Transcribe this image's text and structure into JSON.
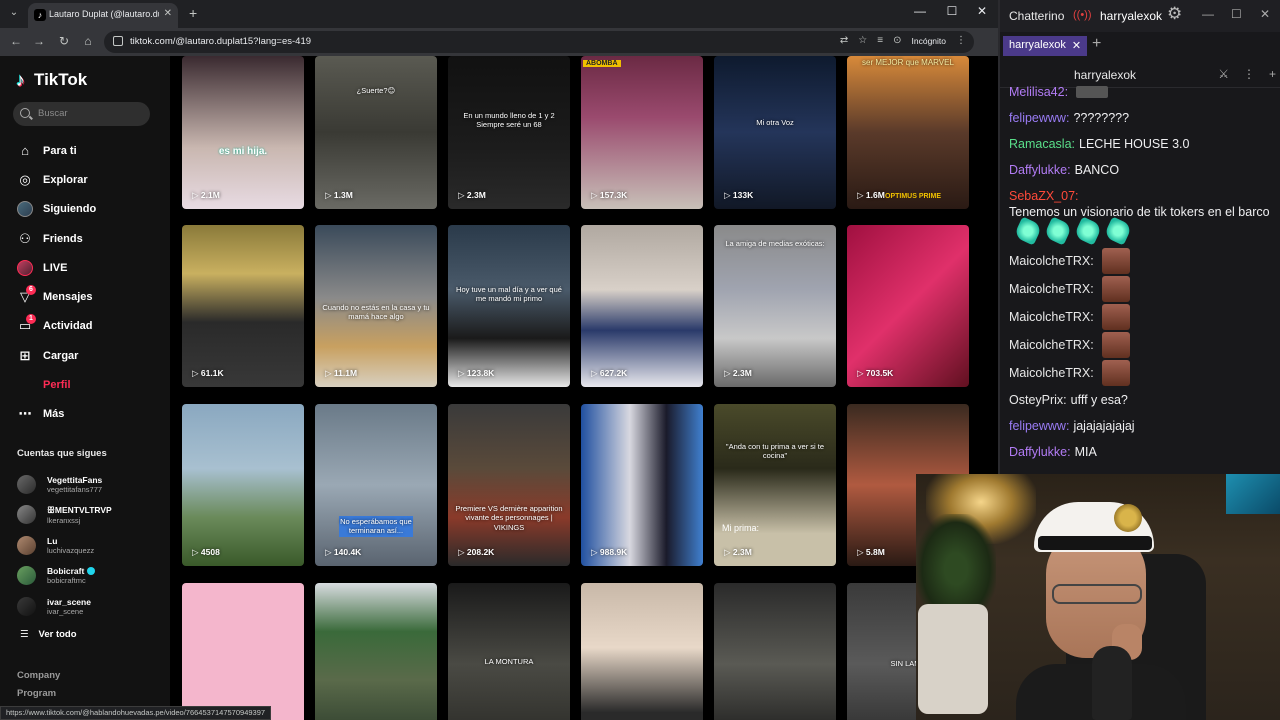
{
  "browser": {
    "tab_title": "Lautaro Duplat (@lautaro.duplat",
    "url": "tiktok.com/@lautaro.duplat15?lang=es-419",
    "incognito_label": "Incógnito",
    "status_url": "https://www.tiktok.com/@hablandohuevadas.pe/video/7664537147570949397"
  },
  "tiktok": {
    "logo": "TikTok",
    "search_placeholder": "Buscar",
    "nav": [
      {
        "label": "Para ti",
        "icon": "home-icon"
      },
      {
        "label": "Explorar",
        "icon": "compass-icon"
      },
      {
        "label": "Siguiendo",
        "icon": "following-avatar-icon"
      },
      {
        "label": "Friends",
        "icon": "friends-icon"
      },
      {
        "label": "LIVE",
        "icon": "live-icon"
      },
      {
        "label": "Mensajes",
        "icon": "messages-icon",
        "badge": "6"
      },
      {
        "label": "Actividad",
        "icon": "activity-icon",
        "badge": "1"
      },
      {
        "label": "Cargar",
        "icon": "upload-icon"
      },
      {
        "label": "Perfil",
        "icon": "profile-icon"
      },
      {
        "label": "Más",
        "icon": "more-icon"
      }
    ],
    "following_title": "Cuentas que sigues",
    "following": [
      {
        "name": "VegettitaFans",
        "handle": "vegettitafans777"
      },
      {
        "name": "ꕥMENTVLTRVP",
        "handle": "lkeranxssj"
      },
      {
        "name": "Lu",
        "handle": "luchivazquezz"
      },
      {
        "name": "Bobicraft",
        "handle": "bobicraftmc",
        "verified": true
      },
      {
        "name": "ivar_scene",
        "handle": "ivar_scene"
      }
    ],
    "see_all": "Ver todo",
    "footer": [
      "Company",
      "Program"
    ]
  },
  "videos": [
    {
      "views": "2.1M",
      "caption": "es mi hija.",
      "bg": "linear-gradient(180deg,#3a2a30,#c9b7b0 60%,#e8dbe3)"
    },
    {
      "views": "1.3M",
      "caption": "¿Suerte?😊",
      "bg": "linear-gradient(180deg,#5a5a52,#3a3a34 50%,#6a6a64)"
    },
    {
      "views": "2.3M",
      "caption": "En un mundo lleno de 1 y 2 Siempre seré un 68",
      "bg": "linear-gradient(180deg,#111,#1c1c1c 60%,#2a2a2a)"
    },
    {
      "views": "157.3K",
      "caption": "",
      "bg": "linear-gradient(180deg,#6b2a44,#9a4a6e 40%,#c8c0b8)"
    },
    {
      "views": "133K",
      "caption": "Mi otra Voz",
      "bg": "linear-gradient(180deg,#0e1a2e,#24355a 50%,#111826)"
    },
    {
      "views": "1.6M",
      "caption": "ser MEJOR que MARVEL",
      "bg": "linear-gradient(180deg,#d88a3a,#5a3a2a 50%,#2a1a14)"
    },
    {
      "views": "61.1K",
      "caption": "",
      "bg": "linear-gradient(180deg,#8a7a3a,#c9b060 30%,#2a2a2a 60%,#383838)"
    },
    {
      "views": "11.1M",
      "caption": "Cuando no estás en la casa y tu mamá hace algo",
      "bg": "linear-gradient(180deg,#3a4a5a,#8a8a8a 45%,#c8a060 75%,#d8d0c0)"
    },
    {
      "views": "123.8K",
      "caption": "Hoy tuve un mal día y a ver qué me mandó mi primo",
      "bg": "linear-gradient(180deg,#2a3a4a,#4a5a6a 40%,#1a1a1a 70%,#e8e8e8)"
    },
    {
      "views": "627.2K",
      "caption": "",
      "bg": "linear-gradient(180deg,#b0a8a0,#d8d0c8 40%,#2a3a6a 65%,#e8e8ee)"
    },
    {
      "views": "2.3M",
      "caption": "La amiga de medias exóticas:",
      "bg": "linear-gradient(180deg,#8a8a8a,#a0a4b0 40%,#c8c8c8 70%,#6a6a6a)"
    },
    {
      "views": "703.5K",
      "caption": "",
      "bg": "linear-gradient(135deg,#a01040,#e0306a 50%,#601020)"
    },
    {
      "views": "4508",
      "caption": "",
      "bg": "linear-gradient(180deg,#8aa8c0,#a8c0d0 40%,#6a8a5a 70%,#3a5a2a)"
    },
    {
      "views": "140.4K",
      "caption": "No esperábamos que terminaran así...",
      "bg": "linear-gradient(180deg,#6a7a88,#9aa8b4 50%,#5a6470)"
    },
    {
      "views": "208.2K",
      "caption": "Premiere VS dernière apparition vivante des personnages | VIKINGS",
      "bg": "linear-gradient(180deg,#3a3a3a,#5a4a3a 40%,#8a3a2a 70%,#2a2a2a)"
    },
    {
      "views": "988.9K",
      "caption": "",
      "bg": "linear-gradient(90deg,#2050a0,#d8d8e0 40%,#1a1a2a 70%,#4080d0)"
    },
    {
      "views": "2.3M",
      "caption": "\"Anda con tu prima a ver si te cocina\"",
      "bg": "linear-gradient(180deg,#4a4a2a,#2a2a1a 40%,#c8c0a8 80%)"
    },
    {
      "views": "5.8M",
      "caption": "",
      "bg": "linear-gradient(180deg,#3a2a20,#b05a40 50%,#2a1a14)"
    },
    {
      "views": "",
      "caption": "",
      "bg": "#f4b6cc"
    },
    {
      "views": "",
      "caption": "",
      "bg": "linear-gradient(180deg,#d8dce0,#3a6a3a 30%,#5a6a4a 60%,#2a3a2a)"
    },
    {
      "views": "",
      "caption": "LA MONTURA",
      "bg": "linear-gradient(180deg,#1a1a1a,#4a4a44 50%,#2a2a26)"
    },
    {
      "views": "",
      "caption": "",
      "bg": "linear-gradient(180deg,#c8b8a8,#e8d8c8 40%,#2a2a2a 80%)"
    },
    {
      "views": "",
      "caption": "",
      "bg": "linear-gradient(180deg,#2a2a2a,#5a5a54 50%,#1a1a1a)"
    },
    {
      "views": "",
      "caption": "SIN LAME",
      "bg": "linear-gradient(180deg,#3a3a3a,#5a5a5a 50%,#2a2a2a)"
    }
  ],
  "tile_overlays": {
    "optimus": "OPTIMUS PRIME",
    "mi_prima": "Mi prima:",
    "abomba": "ABOMBA"
  },
  "chat": {
    "app_name": "Chatterino",
    "channel": "harryalexok",
    "tab_label": "harryalexok",
    "header": "harryalexok",
    "messages": [
      {
        "user": "Melilisa42:",
        "color": "#b27cf5",
        "text": "",
        "emote": "small"
      },
      {
        "user": "felipewww:",
        "color": "#9a7cf5",
        "text": "????????"
      },
      {
        "user": "Ramacasla:",
        "color": "#5adf8a",
        "text": "LECHE HOUSE 3.0"
      },
      {
        "user": "Daffylukke:",
        "color": "#b27cf5",
        "text": "BANCO"
      },
      {
        "user": "SebaZX_07:",
        "color": "#ff4a3a",
        "text": "Tenemos un visionario de tik tokers en el barco",
        "emote": "hands"
      },
      {
        "user": "MaicolcheTRX:",
        "color": "#e8e8e8",
        "text": "",
        "emote": "face"
      },
      {
        "user": "MaicolcheTRX:",
        "color": "#e8e8e8",
        "text": "",
        "emote": "face"
      },
      {
        "user": "MaicolcheTRX:",
        "color": "#e8e8e8",
        "text": "",
        "emote": "face"
      },
      {
        "user": "MaicolcheTRX:",
        "color": "#e8e8e8",
        "text": "",
        "emote": "face"
      },
      {
        "user": "MaicolcheTRX:",
        "color": "#e8e8e8",
        "text": "",
        "emote": "face"
      },
      {
        "user": "OsteyPrix:",
        "color": "#e8e8e8",
        "text": "ufff y esa?"
      },
      {
        "user": "felipewww:",
        "color": "#9a7cf5",
        "text": "jajajajajajaj"
      },
      {
        "user": "Daffylukke:",
        "color": "#b27cf5",
        "text": "MIA"
      }
    ]
  }
}
